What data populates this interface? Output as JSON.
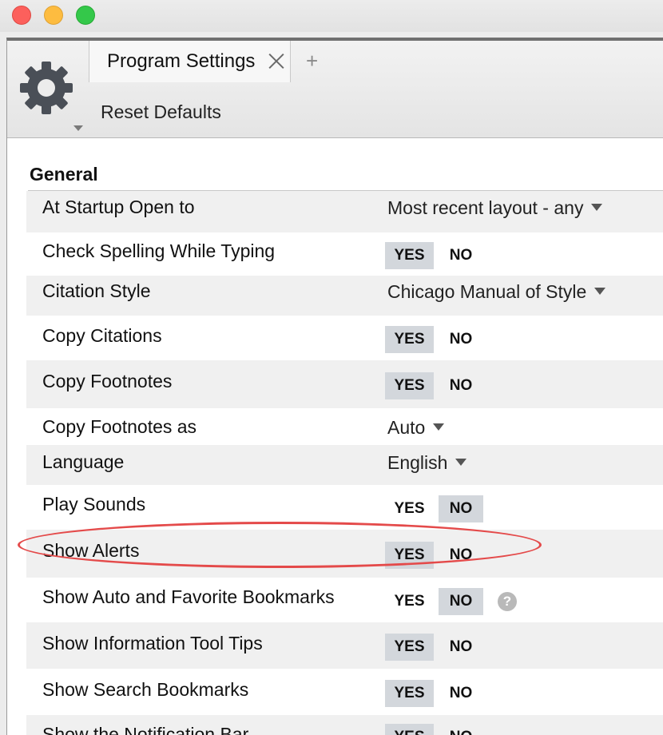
{
  "tab": {
    "label": "Program Settings",
    "add_symbol": "+"
  },
  "toolbar": {
    "reset_label": "Reset Defaults"
  },
  "section": {
    "title": "General"
  },
  "toggle_labels": {
    "yes": "YES",
    "no": "NO"
  },
  "settings": [
    {
      "label": "At Startup Open to",
      "type": "dropdown",
      "value": "Most recent layout - any"
    },
    {
      "label": "Check Spelling While Typing",
      "type": "toggle",
      "value": "YES"
    },
    {
      "label": "Citation Style",
      "type": "dropdown",
      "value": "Chicago Manual of Style"
    },
    {
      "label": "Copy Citations",
      "type": "toggle",
      "value": "YES"
    },
    {
      "label": "Copy Footnotes",
      "type": "toggle",
      "value": "YES"
    },
    {
      "label": "Copy Footnotes as",
      "type": "dropdown",
      "value": "Auto"
    },
    {
      "label": "Language",
      "type": "dropdown",
      "value": "English"
    },
    {
      "label": "Play Sounds",
      "type": "toggle",
      "value": "NO",
      "highlighted": true
    },
    {
      "label": "Show Alerts",
      "type": "toggle",
      "value": "YES"
    },
    {
      "label": "Show Auto and Favorite Bookmarks",
      "type": "toggle",
      "value": "NO",
      "help_icon": "?"
    },
    {
      "label": "Show Information Tool Tips",
      "type": "toggle",
      "value": "YES"
    },
    {
      "label": "Show Search Bookmarks",
      "type": "toggle",
      "value": "YES"
    },
    {
      "label": "Show the Notification Bar",
      "type": "toggle",
      "value": "YES"
    }
  ],
  "colors": {
    "selected_option": "#d3d7dc",
    "highlight_ring": "#e44a4a",
    "alt_row": "#f0f0f0",
    "gear": "#4a4f57"
  },
  "icons": {
    "settings": "gear-icon",
    "close_tab": "close-icon",
    "help": "question-mark-icon"
  }
}
